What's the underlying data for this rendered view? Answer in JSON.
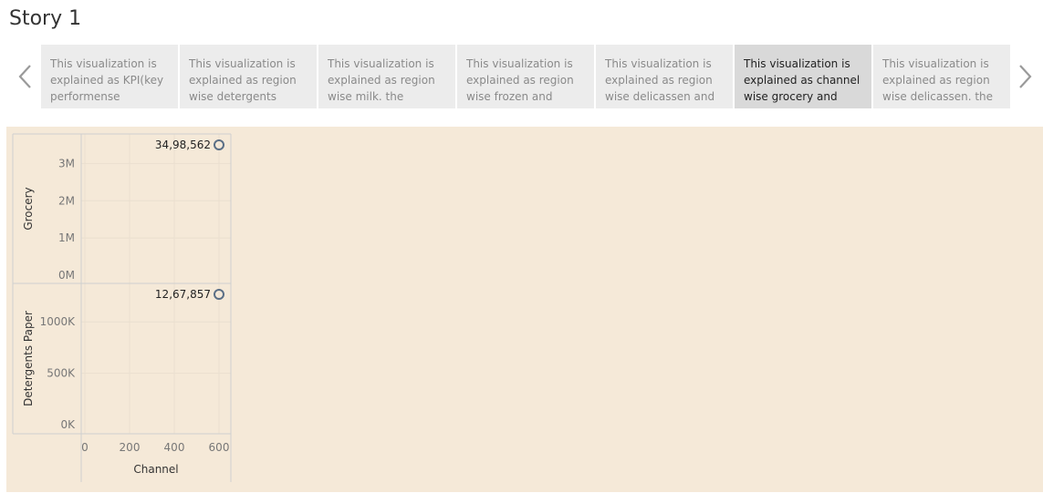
{
  "story": {
    "title": "Story 1"
  },
  "navigation": {
    "prev_icon": "chevron-left-icon",
    "next_icon": "chevron-right-icon"
  },
  "story_points": [
    {
      "text": "This visualization is explained as KPI(key performense",
      "active": false
    },
    {
      "text": "This visualization is explained as region wise detergents paper",
      "active": false
    },
    {
      "text": "This visualization is explained as region wise milk. the highest",
      "active": false
    },
    {
      "text": "This visualization is explained as region wise frozen and",
      "active": false
    },
    {
      "text": "This visualization is explained as region wise delicassen and",
      "active": false
    },
    {
      "text": "This visualization is explained as channel wise grocery and",
      "active": true
    },
    {
      "text": "This visualization is explained as region wise delicassen. the",
      "active": false
    }
  ],
  "colors": {
    "dashboard_bg": "#f5e9d8",
    "marker_stroke": "#5b6f86",
    "active_point_bg": "#d9d9d9",
    "point_bg": "#ececec"
  },
  "chart_data": {
    "type": "scatter",
    "xlabel": "Channel",
    "xlim": [
      0,
      600
    ],
    "x_ticks": [
      "0",
      "200",
      "400",
      "600"
    ],
    "panels": [
      {
        "ylabel": "Grocery",
        "ylim": [
          0,
          3498562
        ],
        "y_ticks": [
          {
            "value": 0,
            "label": "0M"
          },
          {
            "value": 1000000,
            "label": "1M"
          },
          {
            "value": 2000000,
            "label": "2M"
          },
          {
            "value": 3000000,
            "label": "3M"
          }
        ],
        "points": [
          {
            "x": 600,
            "y": 3498562,
            "label": "34,98,562"
          }
        ]
      },
      {
        "ylabel": "Detergents Paper",
        "ylim": [
          0,
          1267857
        ],
        "y_ticks": [
          {
            "value": 0,
            "label": "0K"
          },
          {
            "value": 500000,
            "label": "500K"
          },
          {
            "value": 1000000,
            "label": "1000K"
          }
        ],
        "points": [
          {
            "x": 600,
            "y": 1267857,
            "label": "12,67,857"
          }
        ]
      }
    ],
    "grid": true
  }
}
